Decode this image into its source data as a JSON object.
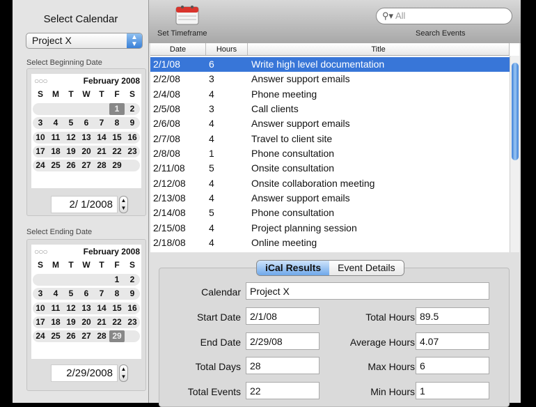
{
  "sidebar": {
    "title": "Select Calendar",
    "calendar_select": "Project X",
    "begin_label": "Select Beginning Date",
    "end_label": "Select Ending Date",
    "begin": {
      "month": "February 2008",
      "days": [
        "S",
        "M",
        "T",
        "W",
        "T",
        "F",
        "S"
      ],
      "weeks": [
        [
          "",
          "",
          "",
          "",
          "",
          "1",
          "2"
        ],
        [
          "3",
          "4",
          "5",
          "6",
          "7",
          "8",
          "9"
        ],
        [
          "10",
          "11",
          "12",
          "13",
          "14",
          "15",
          "16"
        ],
        [
          "17",
          "18",
          "19",
          "20",
          "21",
          "22",
          "23"
        ],
        [
          "24",
          "25",
          "26",
          "27",
          "28",
          "29",
          ""
        ]
      ],
      "selected": "1",
      "date": "2/ 1/2008"
    },
    "end": {
      "month": "February 2008",
      "days": [
        "S",
        "M",
        "T",
        "W",
        "T",
        "F",
        "S"
      ],
      "weeks": [
        [
          "",
          "",
          "",
          "",
          "",
          "1",
          "2"
        ],
        [
          "3",
          "4",
          "5",
          "6",
          "7",
          "8",
          "9"
        ],
        [
          "10",
          "11",
          "12",
          "13",
          "14",
          "15",
          "16"
        ],
        [
          "17",
          "18",
          "19",
          "20",
          "21",
          "22",
          "23"
        ],
        [
          "24",
          "25",
          "26",
          "27",
          "28",
          "29",
          ""
        ]
      ],
      "selected": "29",
      "date": "2/29/2008"
    }
  },
  "toolbar": {
    "set_timeframe": "Set Timeframe",
    "search_placeholder": "All",
    "search_label": "Search Events"
  },
  "table": {
    "columns": [
      "Date",
      "Hours",
      "Title"
    ],
    "rows": [
      [
        "2/1/08",
        "6",
        "Write high level documentation"
      ],
      [
        "2/2/08",
        "3",
        "Answer support emails"
      ],
      [
        "2/4/08",
        "4",
        "Phone meeting"
      ],
      [
        "2/5/08",
        "3",
        "Call clients"
      ],
      [
        "2/6/08",
        "4",
        "Answer support emails"
      ],
      [
        "2/7/08",
        "4",
        "Travel to client site"
      ],
      [
        "2/8/08",
        "1",
        "Phone consultation"
      ],
      [
        "2/11/08",
        "5",
        "Onsite consultation"
      ],
      [
        "2/12/08",
        "4",
        "Onsite collaboration meeting"
      ],
      [
        "2/13/08",
        "4",
        "Answer support emails"
      ],
      [
        "2/14/08",
        "5",
        "Phone consultation"
      ],
      [
        "2/15/08",
        "4",
        "Project planning session"
      ],
      [
        "2/18/08",
        "4",
        "Online meeting"
      ]
    ],
    "selected_row": 0
  },
  "tabs": [
    "iCal Results",
    "Event Details"
  ],
  "results": {
    "calendar_label": "Calendar",
    "calendar": "Project X",
    "left": [
      [
        "Start Date",
        "2/1/08"
      ],
      [
        "End Date",
        "2/29/08"
      ],
      [
        "Total Days",
        "28"
      ],
      [
        "Total Events",
        "22"
      ]
    ],
    "right": [
      [
        "Total Hours",
        "89.5"
      ],
      [
        "Average Hours",
        "4.07"
      ],
      [
        "Max Hours",
        "6"
      ],
      [
        "Min Hours",
        "1"
      ]
    ]
  }
}
